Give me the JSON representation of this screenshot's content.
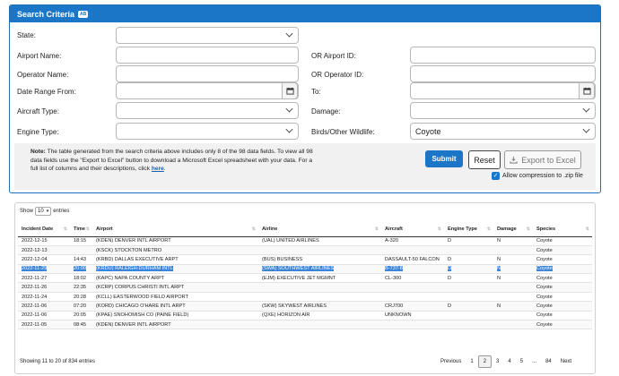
{
  "panel": {
    "title": "Search Criteria",
    "badge": "AB"
  },
  "form": {
    "state_label": "State:",
    "airport_name_label": "Airport Name:",
    "airport_id_label": "OR Airport ID:",
    "operator_name_label": "Operator Name:",
    "operator_id_label": "OR Operator ID:",
    "date_from_label": "Date Range From:",
    "date_to_label": "To:",
    "aircraft_type_label": "Aircraft Type:",
    "damage_label": "Damage:",
    "engine_type_label": "Engine Type:",
    "wildlife_label": "Birds/Other Wildlife:",
    "wildlife_value": "Coyote"
  },
  "note": {
    "bold": "Note:",
    "text": " The table generated from the search criteria above includes only 8 of the 98 data fields. To view all 98 data fields use the \"Export to Excel\" button to download a Microsoft Excel spreadsheet with your data. For a full list of columns and their descriptions, click ",
    "link": "here",
    "end": "."
  },
  "buttons": {
    "submit": "Submit",
    "reset": "Reset",
    "export": "Export to Excel",
    "compression": "Allow compression to .zip file"
  },
  "table": {
    "show_label": "Show",
    "show_value": "10",
    "entries_label": "entries",
    "columns": [
      "Incident Date",
      "Time",
      "Airport",
      "Airline",
      "Aircraft",
      "Engine Type",
      "Damage",
      "Species"
    ],
    "rows": [
      [
        "2022-12-15",
        "18:15",
        "(KDEN) DENVER INTL AIRPORT",
        "(UAL) UNITED AIRLINES",
        "A-320",
        "D",
        "N",
        "Coyote"
      ],
      [
        "2022-12-13",
        "",
        "(KSCK) STOCKTON METRO",
        "",
        "",
        "",
        "",
        "Coyote"
      ],
      [
        "2022-12-04",
        "14:43",
        "(KRBD) DALLAS EXECUTIVE ARPT",
        "(BUS) BUSINESS",
        "DASSAULT-50 FALCON",
        "D",
        "N",
        "Coyote"
      ],
      [
        "2022-11-29",
        "20:00",
        "(KRDU) RALEIGH-DURHAM INTL",
        "(SWA) SOUTHWEST AIRLINES",
        "B-737-8",
        "D",
        "N",
        "Coyote"
      ],
      [
        "2022-11-27",
        "18:02",
        "(KAPC) NAPA COUNTY ARPT",
        "(EJM) EXECUTIVE JET MGMNT",
        "CL-300",
        "D",
        "N",
        "Coyote"
      ],
      [
        "2022-11-26",
        "22:35",
        "(KCRP) CORPUS CHRISTI INTL ARPT",
        "",
        "",
        "",
        "",
        "Coyote"
      ],
      [
        "2022-11-24",
        "20:28",
        "(KCLL) EASTERWOOD FIELD AIRPORT",
        "",
        "",
        "",
        "",
        "Coyote"
      ],
      [
        "2022-11-06",
        "07:20",
        "(KORD) CHICAGO O'HARE INTL ARPT",
        "(SKW) SKYWEST AIRLINES",
        "CRJ700",
        "D",
        "N",
        "Coyote"
      ],
      [
        "2022-11-06",
        "20:05",
        "(KPAE) SNOHOMISH CO (PAINE FIELD)",
        "(QXE) HORIZON AIR",
        "UNKNOWN",
        "",
        "",
        "Coyote"
      ],
      [
        "2022-11-05",
        "08:45",
        "(KDEN) DENVER INTL AIRPORT",
        "",
        "",
        "",
        "",
        "Coyote"
      ]
    ],
    "info": "Showing 11 to 20 of 834 entries"
  },
  "pager": {
    "prev": "Previous",
    "pages": [
      "1",
      "2",
      "3",
      "4",
      "5",
      "...",
      "84"
    ],
    "current": "2",
    "next": "Next"
  }
}
